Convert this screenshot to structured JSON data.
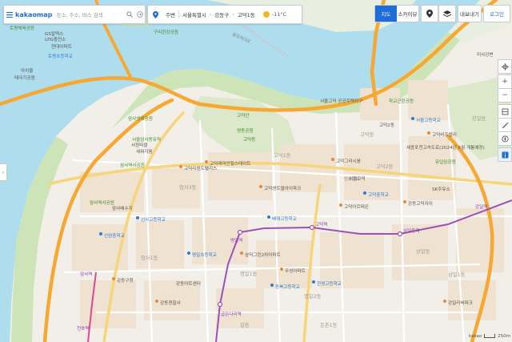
{
  "search": {
    "brand": "kakaomap",
    "placeholder": "장소, 주소, 버스 검색"
  },
  "location": {
    "around": "주변",
    "city": "서울특별시",
    "district": "강동구",
    "dong": "고덕1동",
    "temp": "-11°C"
  },
  "maptype": {
    "map": "지도",
    "skyview": "스카이뷰"
  },
  "actions": {
    "share": "내보내기",
    "login": "로그인"
  },
  "footer": {
    "brand": "kakao",
    "scale": "250m"
  },
  "colors": {
    "water": "#aeddee",
    "expressway": "#f7a833",
    "green": "#cde3b8",
    "residential": "#efe2d0",
    "blue_accent": "#1f6dd9",
    "subway_line5": "#9b51b8",
    "subway_line8": "#e2468c"
  },
  "map": {
    "area_labels": [
      "암사3동",
      "암사1동",
      "고덕1동",
      "고덕2동",
      "명일1동",
      "명일2동",
      "상일동",
      "길동",
      "둔촌1동",
      "강일동",
      "고덕동",
      "상일1동"
    ],
    "places": [
      {
        "t": "토평체육공원",
        "c": "green"
      },
      {
        "t": "GS칼텍스",
        "c": "dark"
      },
      {
        "t": "LPG충전소",
        "c": "dark"
      },
      {
        "t": "현대아파트",
        "c": "dark"
      },
      {
        "t": "토평초등학교",
        "c": "blue"
      },
      {
        "t": "아치울",
        "c": "dark"
      },
      {
        "t": "태극기공원",
        "c": "dark"
      },
      {
        "t": "구리한강공원",
        "c": "green"
      },
      {
        "t": "암사생태공원",
        "c": "green"
      },
      {
        "t": "서울암사동유적",
        "c": "green"
      },
      {
        "t": "암사역사공원",
        "c": "green"
      },
      {
        "t": "암사배수지",
        "c": "dark"
      },
      {
        "t": "서원마을",
        "c": "dark"
      },
      {
        "t": "세워지움",
        "c": "dark"
      },
      {
        "t": "고덕산",
        "c": "green"
      },
      {
        "t": "명동공원",
        "c": "green"
      },
      {
        "t": "학교근린공원",
        "c": "green"
      },
      {
        "t": "고덕동",
        "c": "green"
      },
      {
        "t": "고덕리엔트팰리스",
        "c": "dark"
      },
      {
        "t": "고덕래미안힐스테이트",
        "c": "dark"
      },
      {
        "t": "고덕센트럴아이파크",
        "c": "dark"
      },
      {
        "t": "고덕그라시움",
        "c": "dark"
      },
      {
        "t": "고덕2동",
        "c": "dark"
      },
      {
        "t": "고덕아르테온",
        "c": "dark"
      },
      {
        "t": "강동고덕자이",
        "c": "dark"
      },
      {
        "t": "명일역",
        "c": "purple"
      },
      {
        "t": "굽은다리역",
        "c": "purple"
      },
      {
        "t": "고덕역",
        "c": "purple"
      },
      {
        "t": "상일동역",
        "c": "purple"
      },
      {
        "t": "강일역",
        "c": "purple"
      },
      {
        "t": "서울고덕",
        "c": "dark"
      },
      {
        "t": "유입임공원",
        "c": "green"
      },
      {
        "t": "고덕중학교",
        "c": "blue"
      },
      {
        "t": "한영고등학교",
        "c": "blue"
      },
      {
        "t": "배재고등학교",
        "c": "blue"
      },
      {
        "t": "동북고등학교",
        "c": "blue"
      },
      {
        "t": "명일초등학교",
        "c": "blue"
      },
      {
        "t": "강동구청",
        "c": "dark"
      },
      {
        "t": "암사역",
        "c": "purple"
      },
      {
        "t": "천호역",
        "c": "purple"
      },
      {
        "t": "우성아파트",
        "c": "dark"
      },
      {
        "t": "삼익그린2차아파트",
        "c": "dark"
      },
      {
        "t": "선사고등학교",
        "c": "blue"
      },
      {
        "t": "신암중학교",
        "c": "blue"
      },
      {
        "t": "강동경찰서",
        "c": "dark"
      },
      {
        "t": "서울고등학교",
        "c": "blue"
      },
      {
        "t": "강일리버파크",
        "c": "dark"
      },
      {
        "t": "미사강변",
        "c": "dark"
      },
      {
        "t": "고덕비즈밸리",
        "c": "dark"
      },
      {
        "t": "SK주유소",
        "c": "dark"
      },
      {
        "t": "암사역사공원",
        "c": "green"
      },
      {
        "t": "강동아트센터",
        "c": "dark"
      },
      {
        "t": "서울고덕 공공주택지구",
        "c": "dark"
      },
      {
        "t": "올림픽대로",
        "c": "road"
      },
      {
        "t": "세종포천고속도로(2024년 6월 개통예정)",
        "c": "dark"
      },
      {
        "t": "천호대로",
        "c": "road"
      }
    ]
  }
}
